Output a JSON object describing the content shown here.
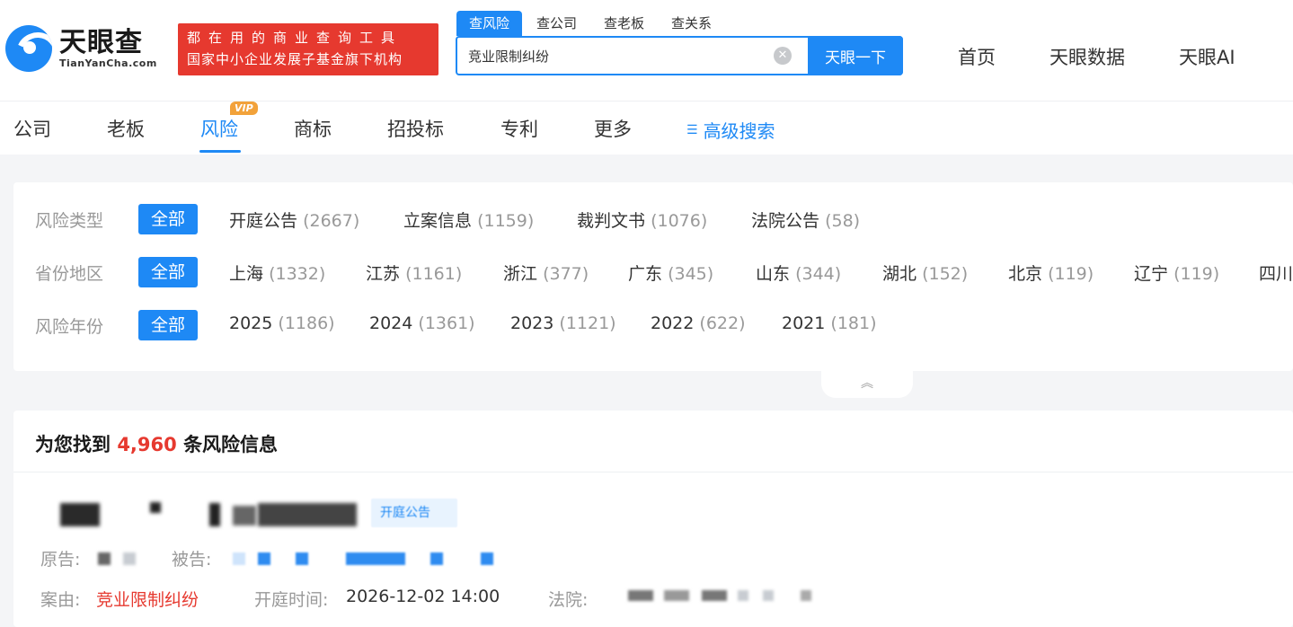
{
  "brand": {
    "name_cn": "天眼查",
    "name_en": "TianYanCha.com",
    "slogan_line1": "都在用的商业查询工具",
    "slogan_line2": "国家中小企业发展子基金旗下机构",
    "color": "#1e89f5"
  },
  "search": {
    "tabs": [
      "查风险",
      "查公司",
      "查老板",
      "查关系"
    ],
    "active_tab": "查风险",
    "query": "竞业限制纠纷",
    "button_label": "天眼一下",
    "clear_icon": "clear-circle-icon"
  },
  "top_nav": [
    "首页",
    "天眼数据",
    "天眼AI"
  ],
  "categories": {
    "items": [
      "公司",
      "老板",
      "风险",
      "商标",
      "招投标",
      "专利",
      "更多"
    ],
    "active": "风险",
    "vip_badge": "VIP",
    "advanced_search": "高级搜索"
  },
  "filters": {
    "all_label": "全部",
    "risk_type": {
      "label": "风险类型",
      "options": [
        {
          "name": "开庭公告",
          "count": "(2667)"
        },
        {
          "name": "立案信息",
          "count": "(1159)"
        },
        {
          "name": "裁判文书",
          "count": "(1076)"
        },
        {
          "name": "法院公告",
          "count": "(58)"
        }
      ]
    },
    "province": {
      "label": "省份地区",
      "options": [
        {
          "name": "上海",
          "count": "(1332)"
        },
        {
          "name": "江苏",
          "count": "(1161)"
        },
        {
          "name": "浙江",
          "count": "(377)"
        },
        {
          "name": "广东",
          "count": "(345)"
        },
        {
          "name": "山东",
          "count": "(344)"
        },
        {
          "name": "湖北",
          "count": "(152)"
        },
        {
          "name": "北京",
          "count": "(119)"
        },
        {
          "name": "辽宁",
          "count": "(119)"
        },
        {
          "name": "四川",
          "count": ""
        }
      ]
    },
    "year": {
      "label": "风险年份",
      "options": [
        {
          "name": "2025",
          "count": "(1186)"
        },
        {
          "name": "2024",
          "count": "(1361)"
        },
        {
          "name": "2023",
          "count": "(1121)"
        },
        {
          "name": "2022",
          "count": "(622)"
        },
        {
          "name": "2021",
          "count": "(181)"
        }
      ]
    },
    "collapse_icon": "chevron-double-up-icon"
  },
  "results": {
    "prefix": "为您找到",
    "count": "4,960",
    "suffix": "条风险信息",
    "item": {
      "tag": "开庭公告",
      "plaintiff_label": "原告:",
      "defendant_label": "被告:",
      "case_label": "案由:",
      "case_value": "竞业限制纠纷",
      "time_label": "开庭时间:",
      "time_value": "2026-12-02 14:00",
      "court_label": "法院:"
    }
  }
}
